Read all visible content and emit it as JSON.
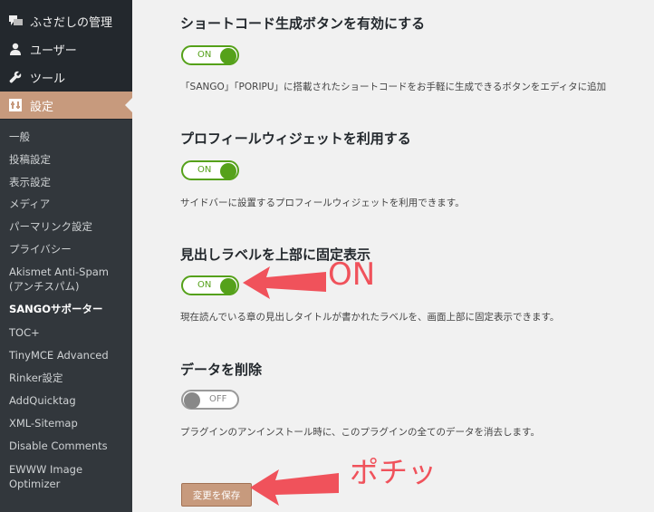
{
  "sidebar": {
    "top_items": [
      {
        "label": "ふさだしの管理",
        "icon": "speech-bubble-icon"
      },
      {
        "label": "ユーザー",
        "icon": "user-icon"
      },
      {
        "label": "ツール",
        "icon": "wrench-icon"
      },
      {
        "label": "設定",
        "icon": "settings-icon"
      }
    ],
    "sub_items": [
      "一般",
      "投稿設定",
      "表示設定",
      "メディア",
      "パーマリンク設定",
      "プライバシー",
      "Akismet Anti-Spam (アンチスパム)",
      "SANGOサポーター",
      "TOC+",
      "TinyMCE Advanced",
      "Rinker設定",
      "AddQuicktag",
      "XML-Sitemap",
      "Disable Comments",
      "EWWW Image Optimizer"
    ]
  },
  "settings": [
    {
      "heading": "ショートコード生成ボタンを有効にする",
      "toggle": "ON",
      "desc": "「SANGO」「PORIPU」に搭載されたショートコードをお手軽に生成できるボタンをエディタに追加"
    },
    {
      "heading": "プロフィールウィジェットを利用する",
      "toggle": "ON",
      "desc": "サイドバーに設置するプロフィールウィジェットを利用できます。"
    },
    {
      "heading": "見出しラベルを上部に固定表示",
      "toggle": "ON",
      "desc": "現在読んでいる章の見出しタイトルが書かれたラベルを、画面上部に固定表示できます。"
    },
    {
      "heading": "データを削除",
      "toggle": "OFF",
      "desc": "プラグインのアンインストール時に、このプラグインの全てのデータを消去します。"
    }
  ],
  "save_label": "変更を保存",
  "annotations": {
    "on_text": "ON",
    "pochi_text": "ポチッ",
    "color": "#f0525b"
  }
}
